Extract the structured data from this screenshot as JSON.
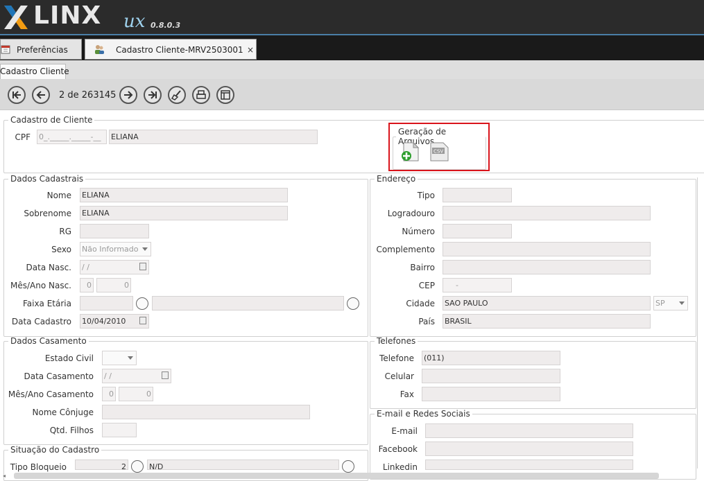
{
  "app": {
    "brand": "LINX",
    "brand_suffix": "ux",
    "version": "0.8.0.3"
  },
  "tabs": [
    {
      "label": "Preferências",
      "icon": "calendar-icon"
    },
    {
      "label": "Cadastro Cliente-MRV2503001",
      "icon": "users-icon",
      "close": "×"
    }
  ],
  "subtab": {
    "label": "Cadastro Cliente"
  },
  "toolbar": {
    "record_position": "2 de 263145",
    "buttons": [
      "first-record",
      "previous-record",
      "next-record",
      "last-record",
      "clear",
      "print",
      "window"
    ]
  },
  "cadastro": {
    "legend": "Cadastro de Cliente",
    "cpf_label": "CPF",
    "cpf_placeholder": "0_._____._____-__",
    "cpf_name": "ELIANA"
  },
  "geracao": {
    "legend": "Geração de Arquivos",
    "icons": [
      "new-file-icon",
      "csv-file-icon"
    ],
    "csv_text": "CSV"
  },
  "dados_cadastrais": {
    "legend": "Dados Cadastrais",
    "nome_label": "Nome",
    "nome": "ELIANA",
    "sobrenome_label": "Sobrenome",
    "sobrenome": "ELIANA",
    "rg_label": "RG",
    "sexo_label": "Sexo",
    "sexo": "Não Informado",
    "data_nasc_label": "Data Nasc.",
    "data_nasc": " / /",
    "mes_ano_label": "Mês/Ano Nasc.",
    "mes": "0",
    "ano": "0",
    "faixa_label": "Faixa Etária",
    "data_cadastro_label": "Data Cadastro",
    "data_cadastro": "10/04/2010"
  },
  "endereco": {
    "legend": "Endereço",
    "tipo_label": "Tipo",
    "logradouro_label": "Logradouro",
    "numero_label": "Número",
    "complemento_label": "Complemento",
    "bairro_label": "Bairro",
    "cep_label": "CEP",
    "cep": "-",
    "cidade_label": "Cidade",
    "cidade": "SAO PAULO",
    "uf": "SP",
    "pais_label": "País",
    "pais": "BRASIL"
  },
  "dados_casamento": {
    "legend": "Dados Casamento",
    "estado_civil_label": "Estado Civil",
    "data_casamento_label": "Data Casamento",
    "data_casamento": " / /",
    "mes_ano_label": "Mês/Ano Casamento",
    "mes": "0",
    "ano": "0",
    "conjuge_label": "Nome Cônjuge",
    "filhos_label": "Qtd. Filhos"
  },
  "telefones": {
    "legend": "Telefones",
    "telefone_label": "Telefone",
    "telefone": "(011)",
    "celular_label": "Celular",
    "fax_label": "Fax"
  },
  "redes": {
    "legend": "E-mail e Redes Sociais",
    "email_label": "E-mail",
    "facebook_label": "Facebook",
    "linkedin_label": "Linkedin"
  },
  "situacao": {
    "legend": "Situação do Cadastro",
    "tipo_bloqueio_label": "Tipo Bloqueio",
    "tipo_bloqueio": "2",
    "tipo_bloqueio_desc": "N/D"
  },
  "colors": {
    "header": "#2b2b2b",
    "accent": "#4a7fa8",
    "highlight_border": "#d9141b"
  }
}
